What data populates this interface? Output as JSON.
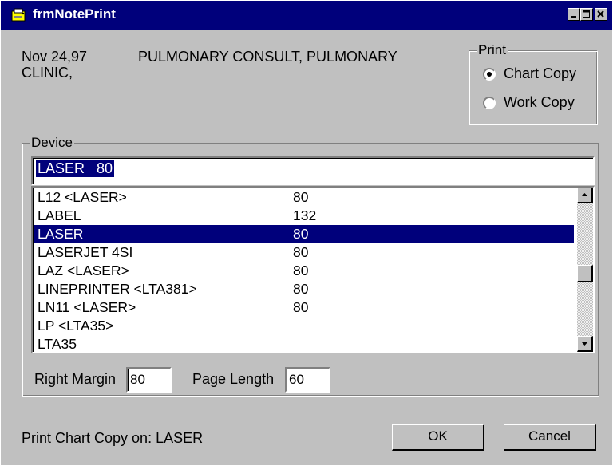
{
  "window": {
    "title": "frmNotePrint",
    "controls": {
      "minimize": "_",
      "maximize": "□",
      "close": "x"
    }
  },
  "note": {
    "date": "Nov 24,97",
    "title": "PULMONARY CONSULT, PULMONARY",
    "location": "CLINIC,"
  },
  "print_group": {
    "caption": "Print",
    "options": [
      {
        "label": "Chart Copy",
        "selected": true
      },
      {
        "label": "Work Copy",
        "selected": false
      }
    ]
  },
  "device_group": {
    "caption": "Device",
    "input_value": "LASER   80",
    "list": {
      "rows": [
        {
          "name": "L12 <LASER>",
          "width": "80"
        },
        {
          "name": "LABEL",
          "width": "132"
        },
        {
          "name": "LASER",
          "width": "80",
          "selected": true
        },
        {
          "name": "LASERJET 4SI",
          "width": "80"
        },
        {
          "name": "LAZ <LASER>",
          "width": "80"
        },
        {
          "name": "LINEPRINTER <LTA381>",
          "width": "80"
        },
        {
          "name": "LN11 <LASER>",
          "width": "80"
        },
        {
          "name": "LP <LTA35>",
          "width": ""
        },
        {
          "name": "LTA35",
          "width": ""
        }
      ],
      "scroll_position": 0.6
    },
    "right_margin_label": "Right Margin",
    "right_margin_value": "80",
    "page_length_label": "Page Length",
    "page_length_value": "60"
  },
  "status": "Print Chart Copy on:  LASER",
  "buttons": {
    "ok": "OK",
    "cancel": "Cancel"
  },
  "colors": {
    "titlebar": "#00007b",
    "selection": "#00007b",
    "face": "#c0c0c0"
  }
}
